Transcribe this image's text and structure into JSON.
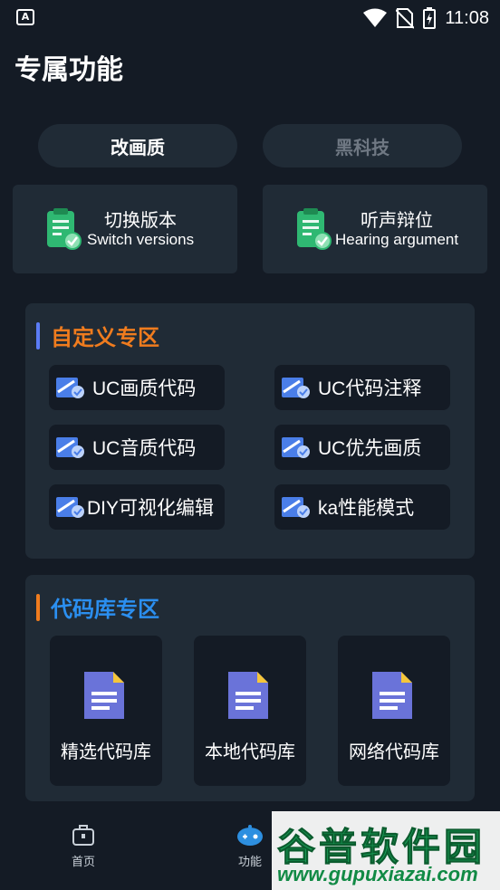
{
  "status_bar": {
    "time": "11:08",
    "app_icon_letter": "A"
  },
  "page_title": "专属功能",
  "tabs": [
    {
      "label": "改画质",
      "active": true
    },
    {
      "label": "黑科技",
      "active": false
    }
  ],
  "feature_cards": [
    {
      "title": "切换版本",
      "subtitle": "Switch versions",
      "icon": "clipboard-check-icon"
    },
    {
      "title": "听声辩位",
      "subtitle": "Hearing argument",
      "icon": "clipboard-check-icon"
    }
  ],
  "custom_section": {
    "title": "自定义专区",
    "accent": "#f07c1e",
    "bar_color": "#5b7cf5",
    "buttons": [
      {
        "label": "UC画质代码",
        "icon": "ruler-check-icon"
      },
      {
        "label": "UC代码注释",
        "icon": "ruler-check-icon"
      },
      {
        "label": "UC音质代码",
        "icon": "ruler-check-icon"
      },
      {
        "label": "UC优先画质",
        "icon": "ruler-check-icon"
      },
      {
        "label": "DIY可视化编辑",
        "icon": "ruler-check-icon"
      },
      {
        "label": "ka性能模式",
        "icon": "ruler-check-icon"
      }
    ]
  },
  "library_section": {
    "title": "代码库专区",
    "accent": "#2b8ff0",
    "bar_color": "#f07c1e",
    "cards": [
      {
        "label": "精选代码库",
        "icon": "document-icon"
      },
      {
        "label": "本地代码库",
        "icon": "document-icon"
      },
      {
        "label": "网络代码库",
        "icon": "document-icon"
      }
    ]
  },
  "bottom_nav": [
    {
      "label": "首页",
      "icon": "home-bag-icon"
    },
    {
      "label": "功能",
      "icon": "robot-icon"
    }
  ],
  "watermark": {
    "text": "谷普软件园",
    "url": "www.gupuxiazai.com"
  }
}
